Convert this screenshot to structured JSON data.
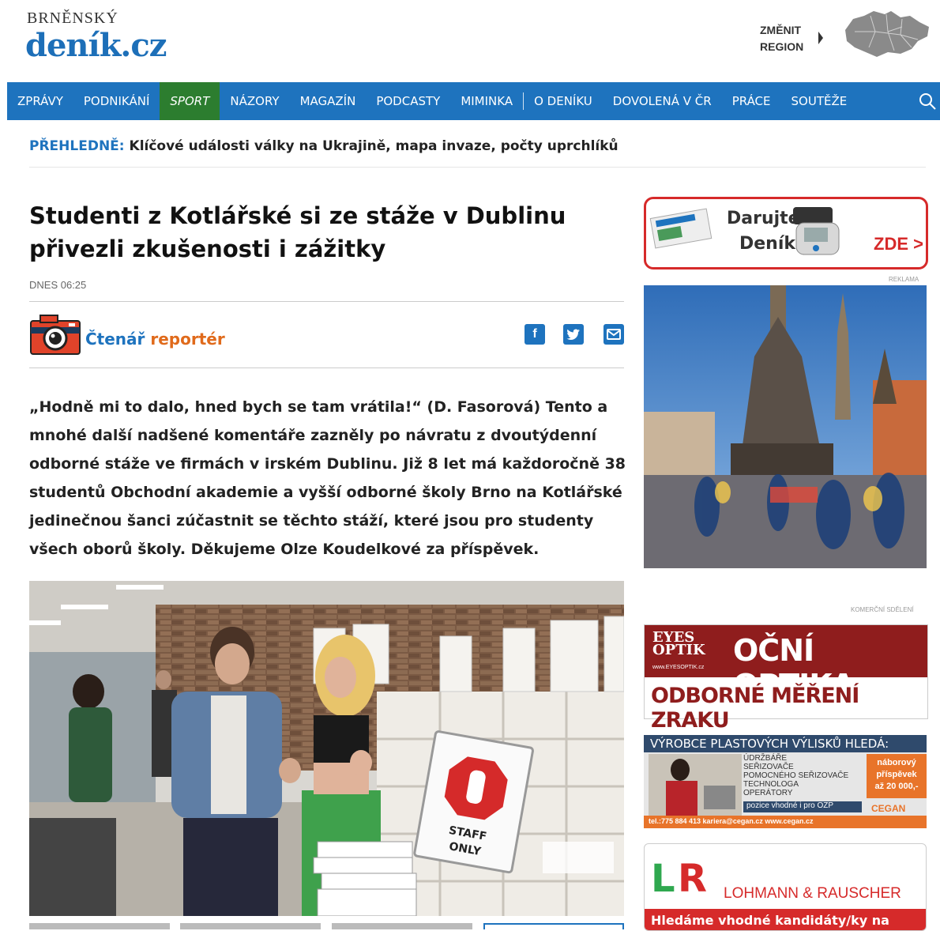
{
  "header": {
    "logo_top": "BRNĚNSKÝ",
    "logo_main": "deník.cz",
    "change_region": "ZMĚNIT\nREGION"
  },
  "nav": {
    "items": [
      "ZPRÁVY",
      "PODNIKÁNÍ",
      "SPORT",
      "NÁZORY",
      "MAGAZÍN",
      "PODCASTY",
      "MIMINKA",
      "O DENÍKU",
      "DOVOLENÁ V ČR",
      "PRÁCE",
      "SOUTĚŽE"
    ],
    "active": "SPORT"
  },
  "breaking": {
    "label": "PŘEHLEDNĚ:",
    "text": "Klíčové události války na Ukrajině, mapa invaze, počty uprchlíků"
  },
  "article": {
    "title": "Studenti z Kotlářské si ze stáže v Dublinu přivezli zkušenosti i zážitky",
    "date": "DNES 06:25",
    "reporter_a": "Čtenář",
    "reporter_b": "reportér",
    "perex": "„Hodně mi to dalo, hned bych se tam vrátila!“ (D. Fasorová) Tento a mnohé další nadšené komentáře zazněly po návratu z dvoutýdenní odborné stáže ve firmách v irském Dublinu. Již 8 let má každoročně 38 studentů Obchodní akademie a vyšší odborné školy Brno na Kotlářské jedinečnou šanci zúčastnit se těchto stáží, které jsou pro studenty všech oborů školy. Děkujeme Olze Koudelkové za příspěvek.",
    "photo_sign": "STAFF\nONLY"
  },
  "ads": {
    "ad1_line1": "Darujte",
    "ad1_line2": "Deník",
    "ad1_cta": "ZDE >",
    "reklama": "REKLAMA",
    "komercni": "KOMERČNÍ SDĚLENÍ",
    "optika_brand": "EYES OPTIK",
    "optika_url": "www.EYESOPTIK.cz",
    "optika_title": "OČNÍ OPTIKA",
    "optika_sub": "ODBORNÉ MĚŘENÍ ZRAKU",
    "cegan_head": "VÝROBCE PLASTOVÝCH VÝLISKŮ HLEDÁ:",
    "cegan_jobs": [
      "ÚDRŽBÁŘE",
      "SEŘIZOVAČE",
      "POMOCNÉHO SEŘIZOVAČE",
      "TECHNOLOGA",
      "OPERÁTORY"
    ],
    "cegan_note": "pozice vhodné i pro OZP",
    "cegan_bonus1": "náborový",
    "cegan_bonus2": "příspěvek",
    "cegan_bonus3": "až 20 000,-",
    "cegan_brand": "CEGAN",
    "cegan_footer": "tel.:775 884 413   kariera@cegan.cz   www.cegan.cz",
    "lr_brand": "LOHMANN & RAUSCHER",
    "lr_footer": "Hledáme vhodné kandidáty/ky na pozice"
  },
  "colors": {
    "brand_blue": "#1e73be",
    "sport_green": "#2c7d2f",
    "reporter_orange": "#e06a1b"
  }
}
